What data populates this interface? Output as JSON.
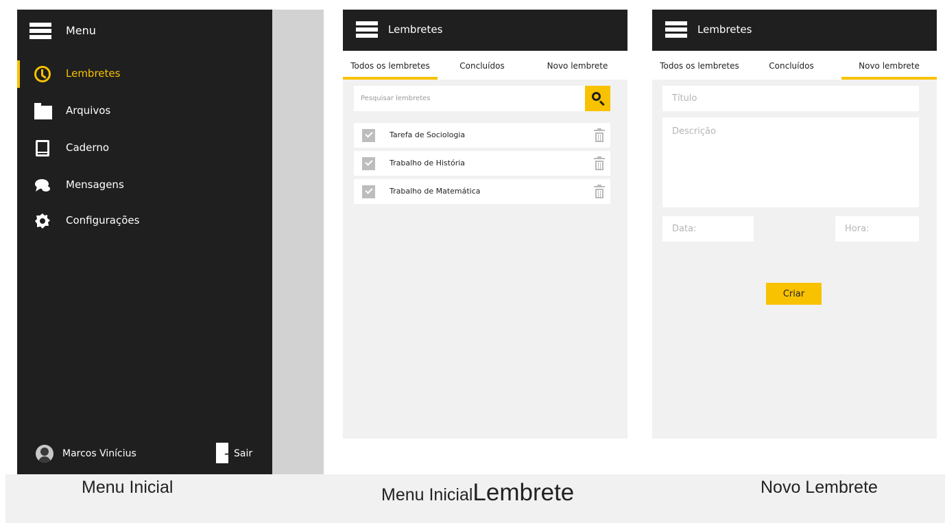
{
  "menu_screen": {
    "title": "Menu",
    "items": [
      {
        "label": "Lembretes",
        "icon": "clock-icon",
        "active": true
      },
      {
        "label": "Arquivos",
        "icon": "folder-icon",
        "active": false
      },
      {
        "label": "Caderno",
        "icon": "notebook-icon",
        "active": false
      },
      {
        "label": "Mensagens",
        "icon": "chat-icon",
        "active": false
      },
      {
        "label": "Configurações",
        "icon": "gear-icon",
        "active": false
      }
    ],
    "user_name": "Marcos Vinícius",
    "logout_label": "Sair"
  },
  "reminders_screen": {
    "title": "Lembretes",
    "tabs": [
      {
        "label": "Todos os lembretes",
        "active": true
      },
      {
        "label": "Concluídos",
        "active": false
      },
      {
        "label": "Novo lembrete",
        "active": false
      }
    ],
    "search_placeholder": "Pesquisar lembretes",
    "reminders": [
      "Tarefa de Sociologia",
      "Trabalho de História",
      "Trabalho de Matemática"
    ]
  },
  "new_reminder_screen": {
    "title": "Lembretes",
    "tabs": [
      {
        "label": "Todos os lembretes",
        "active": false
      },
      {
        "label": "Concluídos",
        "active": false
      },
      {
        "label": "Novo lembrete",
        "active": true
      }
    ],
    "title_placeholder": "Título",
    "description_placeholder": "Descrição",
    "date_placeholder": "Data:",
    "time_placeholder": "Hora:",
    "create_label": "Criar"
  },
  "captions": {
    "first": "Menu Inicial",
    "second_prefix": "Menu Inicial",
    "second_suffix": "Lembrete",
    "third": "Novo Lembrete"
  },
  "colors": {
    "accent": "#f9c200",
    "dark": "#1f1f1f",
    "panel": "#f1f1f1"
  }
}
